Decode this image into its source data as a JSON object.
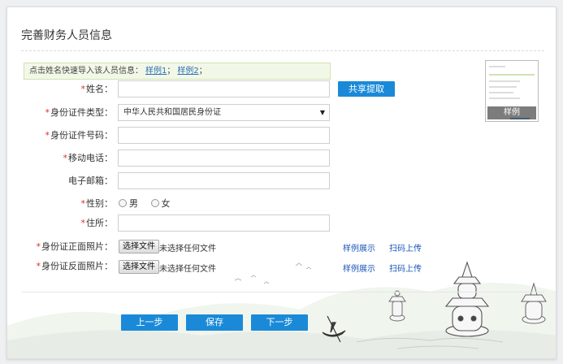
{
  "page": {
    "title": "完善财务人员信息"
  },
  "notice": {
    "text": "点击姓名快速导入该人员信息：",
    "sample1": "样例1",
    "sep": "；",
    "sample2": "样例2",
    "end": "；"
  },
  "form": {
    "name": {
      "label": "姓名：",
      "value": ""
    },
    "share_button": "共享提取",
    "id_type": {
      "label": "身份证件类型：",
      "value": "中华人民共和国居民身份证"
    },
    "id_number": {
      "label": "身份证件号码：",
      "value": ""
    },
    "mobile": {
      "label": "移动电话：",
      "value": ""
    },
    "email": {
      "label": "电子邮箱：",
      "value": ""
    },
    "gender": {
      "label": "性别：",
      "male": "男",
      "female": "女"
    },
    "address": {
      "label": "住所：",
      "value": ""
    },
    "id_front": {
      "label": "身份证正面照片：",
      "choose": "选择文件",
      "status": "未选择任何文件",
      "example_link": "样例展示",
      "scan_link": "扫码上传"
    },
    "id_back": {
      "label": "身份证反面照片：",
      "choose": "选择文件",
      "status": "未选择任何文件",
      "example_link": "样例展示",
      "scan_link": "扫码上传"
    }
  },
  "sample_thumbnail": {
    "caption": "样例"
  },
  "footer": {
    "prev": "上一步",
    "save": "保存",
    "next": "下一步"
  },
  "colors": {
    "primary": "#1a8ad8",
    "required": "#e02b2b",
    "link": "#1b56b8"
  },
  "icons": {
    "select_arrow": "caret-down-icon"
  }
}
